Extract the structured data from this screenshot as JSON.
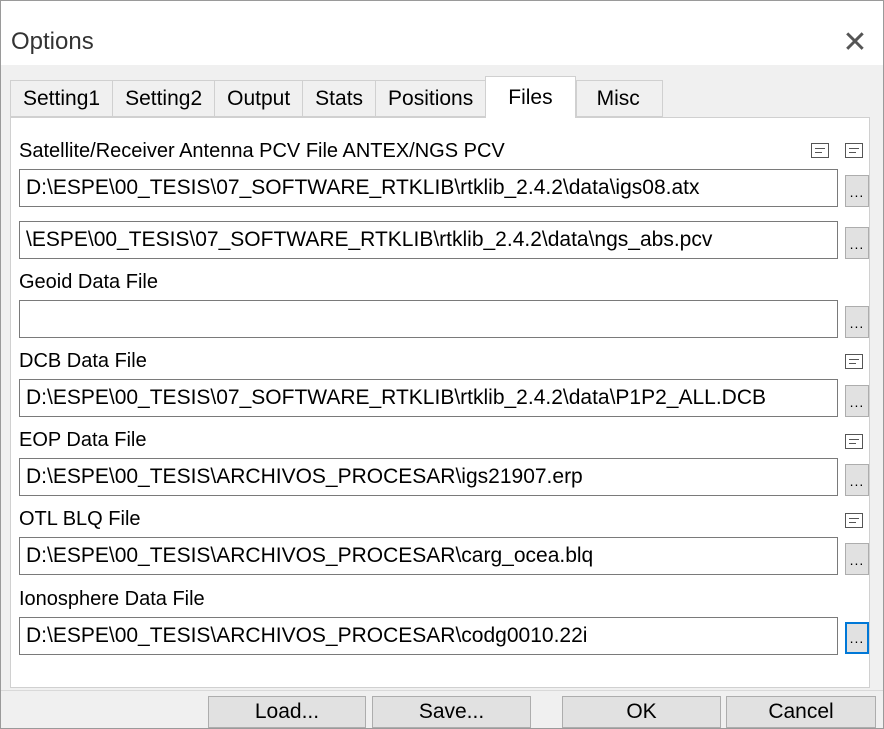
{
  "window": {
    "title": "Options",
    "close_icon": "close-icon"
  },
  "tabs": [
    {
      "label": "Setting1",
      "active": false
    },
    {
      "label": "Setting2",
      "active": false
    },
    {
      "label": "Output",
      "active": false
    },
    {
      "label": "Stats",
      "active": false
    },
    {
      "label": "Positions",
      "active": false
    },
    {
      "label": "Files",
      "active": true
    },
    {
      "label": "Misc",
      "active": false
    }
  ],
  "files": {
    "antenna_label": "Satellite/Receiver Antenna PCV File ANTEX/NGS PCV",
    "antenna_sat_file": "D:\\ESPE\\00_TESIS\\07_SOFTWARE_RTKLIB\\rtklib_2.4.2\\data\\igs08.atx",
    "antenna_rcv_file": "\\ESPE\\00_TESIS\\07_SOFTWARE_RTKLIB\\rtklib_2.4.2\\data\\ngs_abs.pcv",
    "geoid_label": "Geoid Data File",
    "geoid_file": "",
    "dcb_label": "DCB Data File",
    "dcb_file": "D:\\ESPE\\00_TESIS\\07_SOFTWARE_RTKLIB\\rtklib_2.4.2\\data\\P1P2_ALL.DCB",
    "eop_label": "EOP Data File",
    "eop_file": "D:\\ESPE\\00_TESIS\\ARCHIVOS_PROCESAR\\igs21907.erp",
    "otl_label": "OTL BLQ File",
    "otl_file": "D:\\ESPE\\00_TESIS\\ARCHIVOS_PROCESAR\\carg_ocea.blq",
    "iono_label": "Ionosphere Data File",
    "iono_file": "D:\\ESPE\\00_TESIS\\ARCHIVOS_PROCESAR\\codg0010.22i",
    "browse_label": "..."
  },
  "buttons": {
    "load": "Load...",
    "save": "Save...",
    "ok": "OK",
    "cancel": "Cancel"
  },
  "colors": {
    "focus": "#0078d7",
    "panel": "#f0f0f0",
    "button": "#e1e1e1"
  }
}
